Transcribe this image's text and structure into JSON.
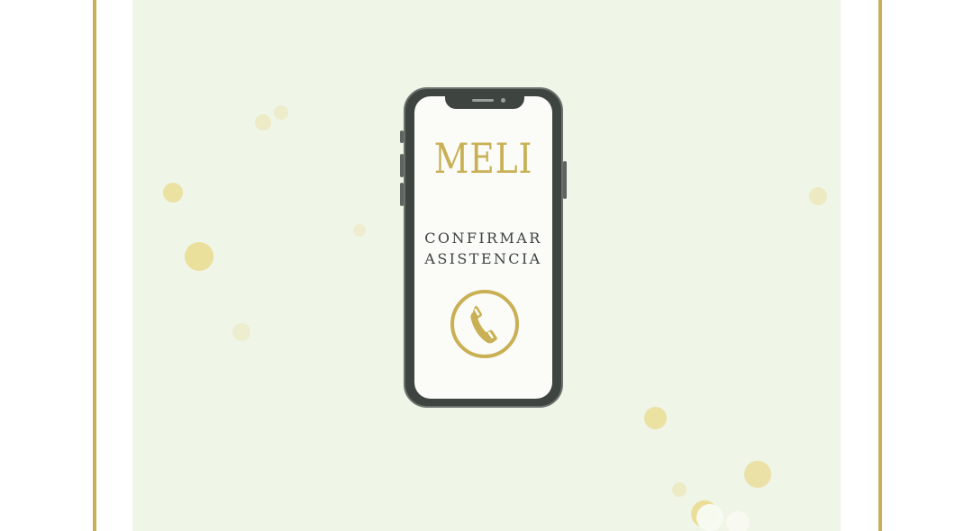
{
  "invitation": {
    "name": "MELI",
    "confirm_line1": "CONFIRMAR",
    "confirm_line2": "ASISTENCIA"
  },
  "icons": {
    "call": "phone-icon"
  },
  "colors": {
    "gold": "#c9b055",
    "panel_background": "#eff5e7",
    "phone_body": "#3e4440",
    "screen": "#fbfbf8",
    "bokeh": "#ead98a"
  }
}
